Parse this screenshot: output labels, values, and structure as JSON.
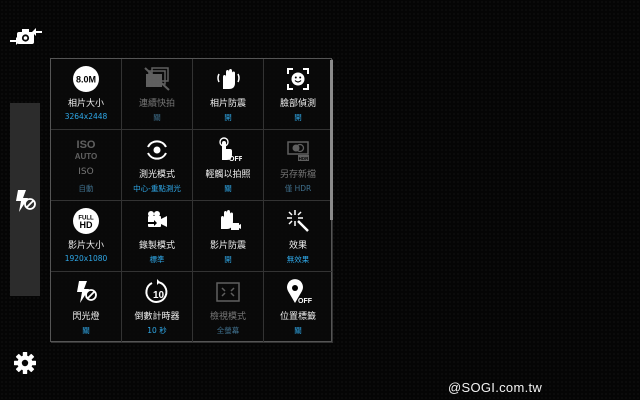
{
  "side": {
    "top_icon": "switch-camera-icon",
    "flash_icon": "flash-off-icon",
    "settings_icon": "gear-icon"
  },
  "settings": [
    {
      "label": "相片大小",
      "value": "3264x2448",
      "icon": "photo-size-icon",
      "badge": "8.0M",
      "enabled": true
    },
    {
      "label": "連續快拍",
      "value": "關",
      "icon": "burst-shot-icon",
      "enabled": false
    },
    {
      "label": "相片防震",
      "value": "開",
      "icon": "anti-shake-hand-icon",
      "enabled": true
    },
    {
      "label": "臉部偵測",
      "value": "開",
      "icon": "face-detection-icon",
      "enabled": true
    },
    {
      "label": "ISO",
      "value": "自動",
      "icon": "iso-auto-icon",
      "enabled": false
    },
    {
      "label": "測光模式",
      "value": "中心-重點測光",
      "icon": "metering-icon",
      "enabled": true
    },
    {
      "label": "輕觸以拍照",
      "value": "關",
      "icon": "tap-to-take-off-icon",
      "enabled": true
    },
    {
      "label": "另存新檔",
      "value": "僅 HDR",
      "icon": "save-hdr-icon",
      "enabled": false
    },
    {
      "label": "影片大小",
      "value": "1920x1080",
      "icon": "video-size-icon",
      "badge": "FULL HD",
      "enabled": true
    },
    {
      "label": "錄製模式",
      "value": "標準",
      "icon": "recording-mode-icon",
      "enabled": true
    },
    {
      "label": "影片防震",
      "value": "開",
      "icon": "video-stabilization-icon",
      "enabled": true
    },
    {
      "label": "效果",
      "value": "無效果",
      "icon": "effects-wand-icon",
      "enabled": true
    },
    {
      "label": "閃光燈",
      "value": "關",
      "icon": "flash-off-icon",
      "enabled": true
    },
    {
      "label": "倒數計時器",
      "value": "10 秒",
      "icon": "timer-10-icon",
      "enabled": true
    },
    {
      "label": "檢視模式",
      "value": "全螢幕",
      "icon": "view-mode-icon",
      "enabled": false
    },
    {
      "label": "位置標籤",
      "value": "關",
      "icon": "location-tag-off-icon",
      "enabled": true
    }
  ],
  "watermark": "@SOGI.com.tw"
}
